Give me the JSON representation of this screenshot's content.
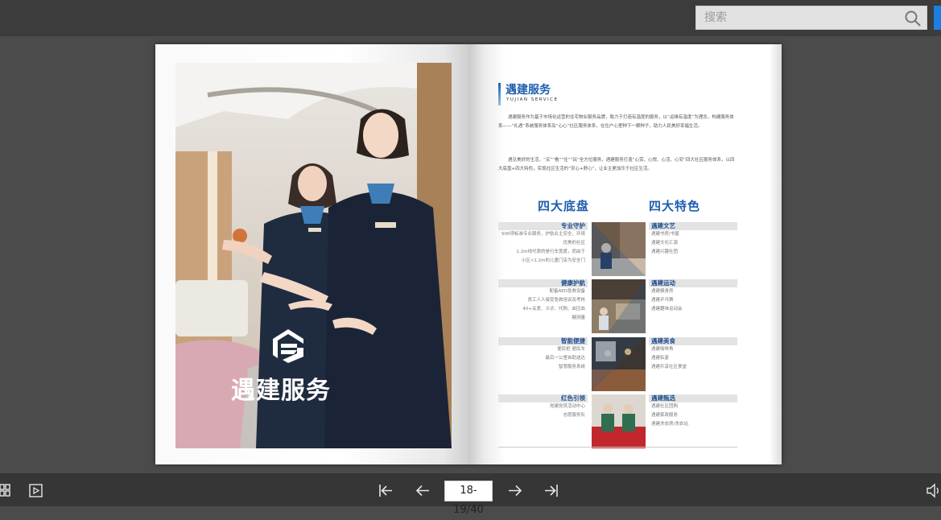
{
  "search": {
    "placeholder": "搜索"
  },
  "book": {
    "left_page": {
      "logo_text": "遇建服务"
    },
    "right_page": {
      "title": "遇建服务",
      "subtitle": "YUJIAN SERVICE",
      "paragraph1": "遇建服务作为基于市场化运营的住宅物业服务品牌，致力于打造有温度的服务，以“运维有温度”为理念，构建服务体系——“礼遇”系统服务体系及“心心”社区服务体系，在住户心里种下一颗种子，助力人民美好幸福生活。",
      "paragraph2": "遇见美好的生活，“买”“看”“住”“玩”全方位服务，遇建服务打造“心赏、心悦、心活、心安”四大社区服务体系，以四大底盘+四大特色，实现社区生活的“安心+舒心”，让业主更加乐于社区生活。",
      "heading_left": "四大底盘",
      "heading_right": "四大特色",
      "left_sections": [
        {
          "title": "专业守护",
          "items": [
            "500项标准专业服务，护航业主安全、环境",
            "优美的社区",
            "1.2m线代表的是行车宽度，而由于",
            "小区<1.2m的儿童门店为安全门"
          ]
        },
        {
          "title": "健康护航",
          "items": [
            "配备AED急救设备",
            "员工人人接受急救培训及考核",
            "40+关爱、义诊、代购、血压血",
            "糖测量"
          ]
        },
        {
          "title": "智能便捷",
          "items": [
            "便民柜 便民车",
            "最后一公里自助送达",
            "智慧服务系统"
          ]
        },
        {
          "title": "红色引领",
          "items": [
            "党建党员活动中心",
            "志愿服务队"
          ]
        }
      ],
      "right_sections": [
        {
          "title": "遇建文艺",
          "items": [
            "遇建书房/书屋",
            "遇建文化汇演",
            "遇建兴趣社团"
          ]
        },
        {
          "title": "遇建运动",
          "items": [
            "遇建健身房",
            "遇建乒乓赛",
            "遇建趣味运动会"
          ]
        },
        {
          "title": "遇建美食",
          "items": [
            "遇建咖啡角",
            "遇建私宴",
            "遇建乐享社区食堂"
          ]
        },
        {
          "title": "遇建甄选",
          "items": [
            "遇建社区团购",
            "遇建家政服务",
            "遇建洗衣房/洗衣站"
          ]
        }
      ]
    }
  },
  "pager": {
    "page_indicator": "18-19/40"
  }
}
